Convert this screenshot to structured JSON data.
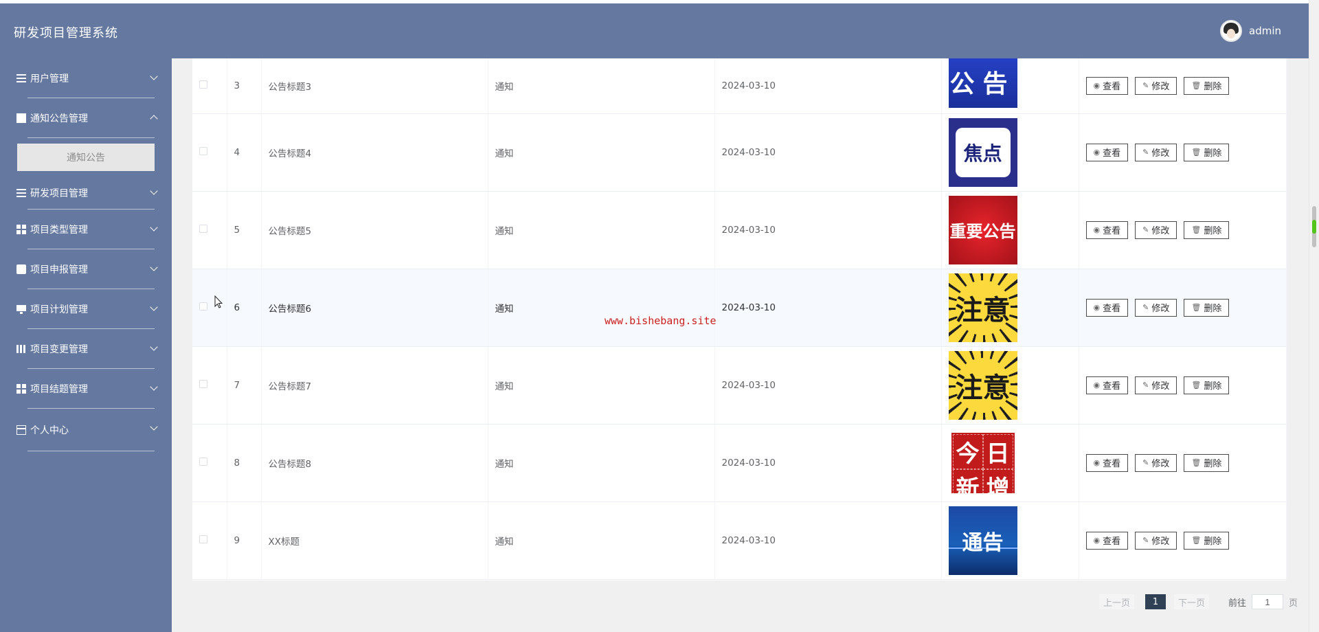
{
  "app": {
    "title": "研发项目管理系统",
    "user": "admin"
  },
  "sidebar": {
    "items": [
      {
        "label": "用户管理",
        "icon": "list-icon",
        "expanded": false
      },
      {
        "label": "通知公告管理",
        "icon": "chart-icon",
        "expanded": true,
        "sub": [
          "通知公告"
        ]
      },
      {
        "label": "研发项目管理",
        "icon": "list-icon",
        "expanded": false
      },
      {
        "label": "项目类型管理",
        "icon": "grid-icon",
        "expanded": false
      },
      {
        "label": "项目申报管理",
        "icon": "clipboard-icon",
        "expanded": false
      },
      {
        "label": "项目计划管理",
        "icon": "monitor-icon",
        "expanded": false
      },
      {
        "label": "项目变更管理",
        "icon": "book-icon",
        "expanded": false
      },
      {
        "label": "项目结题管理",
        "icon": "grid-icon",
        "expanded": false
      },
      {
        "label": "个人中心",
        "icon": "card-icon",
        "expanded": false
      }
    ]
  },
  "table": {
    "rows": [
      {
        "index": "3",
        "title": "公告标题3",
        "type": "通知",
        "date": "2024-03-10",
        "image": "公告",
        "image_style": "blue"
      },
      {
        "index": "4",
        "title": "公告标题4",
        "type": "通知",
        "date": "2024-03-10",
        "image": "焦点",
        "image_style": "focus"
      },
      {
        "index": "5",
        "title": "公告标题5",
        "type": "通知",
        "date": "2024-03-10",
        "image": "重要公告",
        "image_style": "red"
      },
      {
        "index": "6",
        "title": "公告标题6",
        "type": "通知",
        "date": "2024-03-10",
        "image": "注意",
        "image_style": "yellow"
      },
      {
        "index": "7",
        "title": "公告标题7",
        "type": "通知",
        "date": "2024-03-10",
        "image": "注意",
        "image_style": "yellow"
      },
      {
        "index": "8",
        "title": "公告标题8",
        "type": "通知",
        "date": "2024-03-10",
        "image": "今日新增",
        "image_style": "today"
      },
      {
        "index": "9",
        "title": "XX标题",
        "type": "通知",
        "date": "2024-03-10",
        "image": "通告",
        "image_style": "notice"
      }
    ],
    "actions": {
      "view": "查看",
      "edit": "修改",
      "delete": "删除"
    }
  },
  "pagination": {
    "prev": "上一页",
    "current": "1",
    "next": "下一页",
    "goto_label": "前往",
    "goto_value": "1",
    "page_suffix": "页"
  },
  "watermark": "www.bishebang.site",
  "colors": {
    "header_bg": "#6478a0",
    "sidebar_bg": "#6478a0",
    "pager_active": "#304156",
    "watermark": "#cc2020"
  }
}
